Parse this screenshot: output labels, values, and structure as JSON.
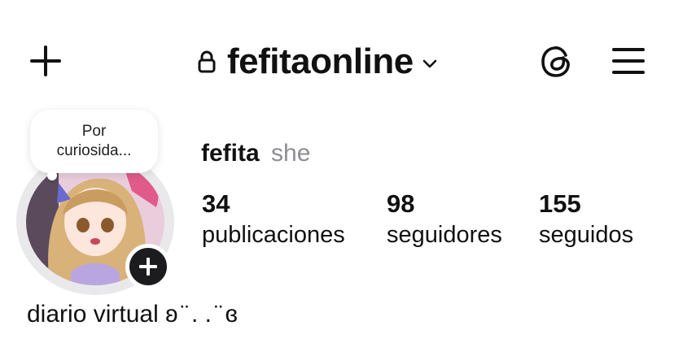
{
  "header": {
    "add_icon": "plus-icon",
    "lock_icon": "lock-icon",
    "username": "fefitaonline",
    "chevron_icon": "chevron-down-icon",
    "threads_icon": "threads-icon",
    "menu_icon": "hamburger-menu-icon"
  },
  "note": {
    "text_line1": "Por",
    "text_line2": "curiosida..."
  },
  "profile": {
    "display_name": "fefita",
    "pronouns": "she",
    "avatar": "anime-girl-avatar",
    "add_story_icon": "plus-icon"
  },
  "stats": [
    {
      "count": "34",
      "label": "publicaciones"
    },
    {
      "count": "98",
      "label": "seguidores"
    },
    {
      "count": "155",
      "label": "seguidos"
    }
  ],
  "bio": "diario virtual ʚ ̈ . . ̈ ɞ",
  "colors": {
    "text": "#111111",
    "muted": "#8e8e93",
    "background": "#ffffff",
    "ring": "#e9e9ec"
  }
}
